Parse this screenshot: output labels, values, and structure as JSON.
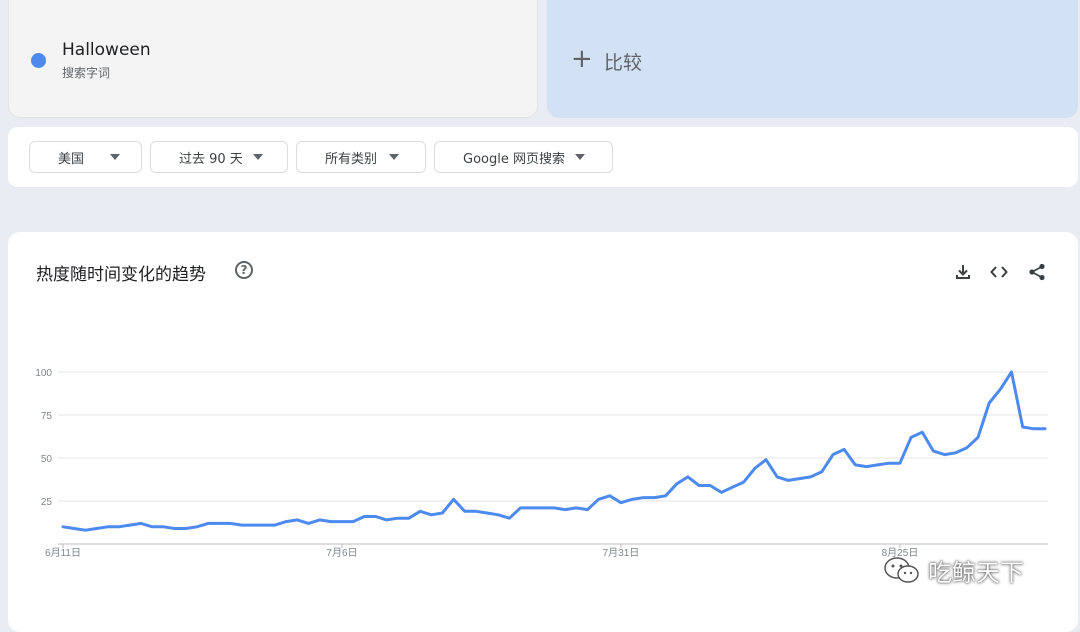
{
  "search_term": {
    "name": "Halloween",
    "type": "搜索字词",
    "color": "#4d8af0"
  },
  "compare": {
    "plus": "+",
    "label": "比较"
  },
  "filters": {
    "region": "美国",
    "time_range": "过去 90 天",
    "category": "所有类别",
    "search_type": "Google 网页搜索"
  },
  "chart_panel": {
    "title": "热度随时间变化的趋势",
    "help": "?",
    "icons": [
      "download-icon",
      "embed-code-icon",
      "share-icon"
    ]
  },
  "watermark": {
    "text": "吃鲸天下",
    "icon": "wechat-icon"
  },
  "chart_data": {
    "type": "line",
    "x_tick_labels": [
      "6月11日",
      "7月6日",
      "7月31日",
      "8月25日"
    ],
    "x_tick_index": [
      0,
      25,
      50,
      75
    ],
    "y_ticks": [
      25,
      50,
      75,
      100
    ],
    "ylim": [
      0,
      100
    ],
    "grid": true,
    "series": [
      {
        "color": "#4d8af0",
        "values": [
          10,
          9,
          8,
          9,
          10,
          10,
          11,
          12,
          10,
          10,
          9,
          9,
          10,
          12,
          12,
          12,
          11,
          11,
          11,
          11,
          13,
          14,
          12,
          14,
          13,
          13,
          13,
          16,
          16,
          14,
          15,
          15,
          19,
          17,
          18,
          26,
          19,
          19,
          18,
          17,
          15,
          21,
          21,
          21,
          21,
          20,
          21,
          20,
          26,
          28,
          24,
          26,
          27,
          27,
          28,
          35,
          39,
          34,
          34,
          30,
          33,
          36,
          44,
          49,
          39,
          37,
          38,
          39,
          42,
          52,
          55,
          46,
          45,
          46,
          47,
          47,
          62,
          65,
          54,
          52,
          53,
          56,
          62,
          82,
          90,
          100,
          68,
          67,
          67
        ]
      }
    ]
  }
}
